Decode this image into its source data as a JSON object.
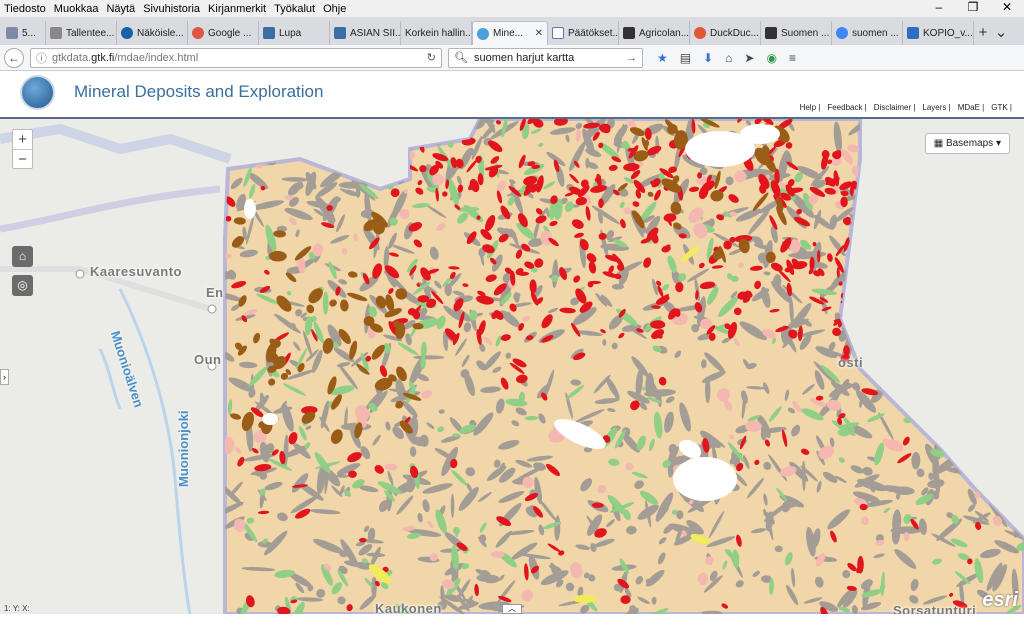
{
  "menubar": {
    "items": [
      "Tiedosto",
      "Muokkaa",
      "Näytä",
      "Sivuhistoria",
      "Kirjanmerkit",
      "Työkalut",
      "Ohje"
    ]
  },
  "tabs": [
    {
      "label": "5..."
    },
    {
      "label": "Tallentee..."
    },
    {
      "label": "Näköisle..."
    },
    {
      "label": "Google ..."
    },
    {
      "label": "Lupa"
    },
    {
      "label": "ASIAN SII..."
    },
    {
      "label": "Korkein hallin..."
    },
    {
      "label": "Mine..."
    },
    {
      "label": "Päätökset..."
    },
    {
      "label": "Agricolan..."
    },
    {
      "label": "DuckDuc..."
    },
    {
      "label": "Suomen ..."
    },
    {
      "label": "suomen ..."
    },
    {
      "label": "KOPIO_v..."
    }
  ],
  "url": {
    "prefix": "gtkdata.",
    "domain": "gtk.fi",
    "path": "/mdae/index.html"
  },
  "search": {
    "value": "suomen harjut kartta"
  },
  "app": {
    "title": "Mineral Deposits and Exploration",
    "links": [
      "Help |",
      "Feedback |",
      "Disclaimer |",
      "Layers |",
      "MDaE |",
      "GTK |"
    ]
  },
  "map": {
    "basemaps_label": "Basemaps",
    "zoom_in": "+",
    "zoom_out": "−",
    "coords": "1:  Y:  X:",
    "attribution": "esri",
    "places": [
      "Kaaresuvanto",
      "En",
      "Oun",
      "osti",
      "Kaukonen",
      "Sorsatunturi"
    ],
    "rivers": [
      "Muonionjoki",
      "Muonioälven"
    ]
  }
}
